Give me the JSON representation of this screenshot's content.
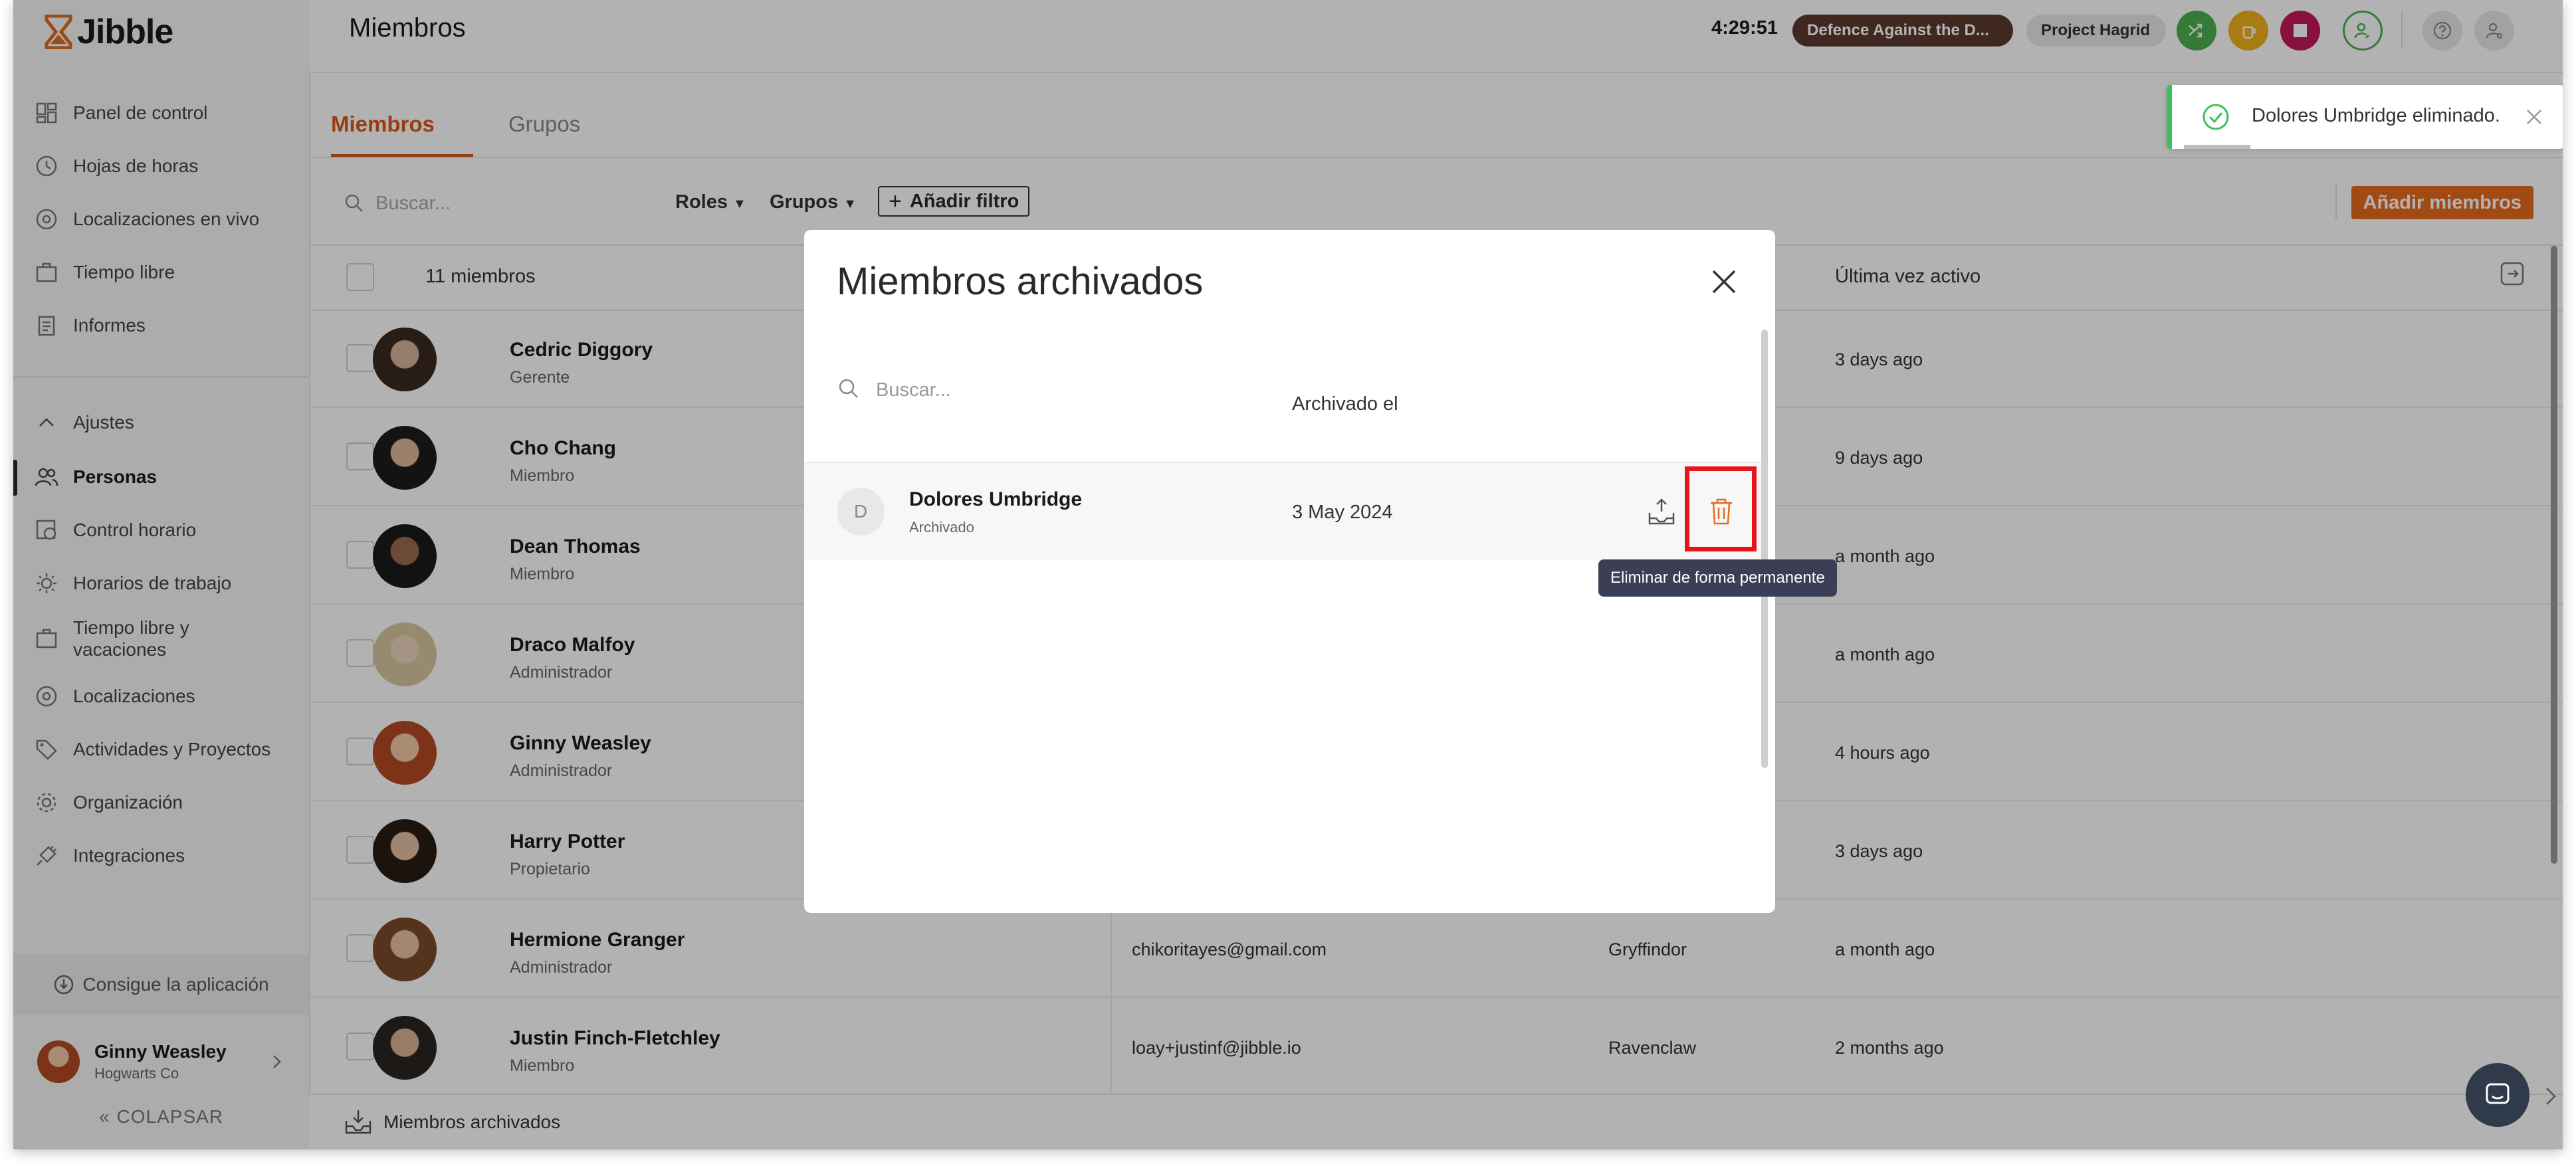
{
  "app": {
    "logo_text": "Jibble"
  },
  "sidebar": {
    "items": [
      {
        "label": "Panel de control",
        "icon": "dashboard-icon"
      },
      {
        "label": "Hojas de horas",
        "icon": "clock-icon"
      },
      {
        "label": "Localizaciones en vivo",
        "icon": "location-pin-icon"
      },
      {
        "label": "Tiempo libre",
        "icon": "suitcase-icon"
      },
      {
        "label": "Informes",
        "icon": "report-icon"
      }
    ],
    "settings_label": "Ajustes",
    "settings_items": [
      {
        "label": "Personas",
        "icon": "people-icon",
        "active": true
      },
      {
        "label": "Control horario",
        "icon": "time-tracking-icon"
      },
      {
        "label": "Horarios de trabajo",
        "icon": "schedule-icon"
      },
      {
        "label": "Tiempo libre y vacaciones",
        "icon": "suitcase-icon"
      },
      {
        "label": "Localizaciones",
        "icon": "location-pin-icon"
      },
      {
        "label": "Actividades y Proyectos",
        "icon": "tag-icon"
      },
      {
        "label": "Organización",
        "icon": "gear-icon"
      },
      {
        "label": "Integraciones",
        "icon": "plug-icon"
      }
    ],
    "get_app": "Consigue la aplicación",
    "profile": {
      "name": "Ginny Weasley",
      "org": "Hogwarts Co"
    },
    "collapse": "COLAPSAR"
  },
  "header": {
    "title": "Miembros",
    "time": "4:29:51",
    "activity_pill": "Defence Against the D...",
    "project_pill": "Project Hagrid"
  },
  "tabs": {
    "members": "Miembros",
    "groups": "Grupos"
  },
  "toolbar": {
    "search_placeholder": "Buscar...",
    "roles": "Roles",
    "groups": "Grupos",
    "add_filter": "Añadir filtro",
    "add_members": "Añadir miembros"
  },
  "table": {
    "count_label": "11 miembros",
    "last_active_header": "Última vez activo",
    "rows": [
      {
        "name": "Cedric Diggory",
        "role": "Gerente",
        "email": "",
        "group": "",
        "last_active": "3 days ago"
      },
      {
        "name": "Cho Chang",
        "role": "Miembro",
        "email": "",
        "group": "",
        "last_active": "9 days ago"
      },
      {
        "name": "Dean Thomas",
        "role": "Miembro",
        "email": "",
        "group": "",
        "last_active": "a month ago"
      },
      {
        "name": "Draco Malfoy",
        "role": "Administrador",
        "email": "",
        "group": "",
        "last_active": "a month ago"
      },
      {
        "name": "Ginny Weasley",
        "role": "Administrador",
        "email": "",
        "group": "",
        "last_active": "4 hours ago"
      },
      {
        "name": "Harry Potter",
        "role": "Propietario",
        "email": "",
        "group": "",
        "last_active": "3 days ago"
      },
      {
        "name": "Hermione Granger",
        "role": "Administrador",
        "email": "chikoritayes@gmail.com",
        "group": "Gryffindor",
        "last_active": "a month ago"
      },
      {
        "name": "Justin Finch-Fletchley",
        "role": "Miembro",
        "email": "loay+justinf@jibble.io",
        "group": "Ravenclaw",
        "last_active": "2 months ago"
      }
    ]
  },
  "footer": {
    "archived_members": "Miembros archivados"
  },
  "modal": {
    "title": "Miembros archivados",
    "search_placeholder": "Buscar...",
    "archived_on_header": "Archivado el",
    "rows": [
      {
        "initial": "D",
        "name": "Dolores Umbridge",
        "status": "Archivado",
        "date": "3 May 2024"
      }
    ],
    "delete_tooltip": "Eliminar de forma permanente"
  },
  "toast": {
    "message": "Dolores Umbridge eliminado."
  },
  "colors": {
    "accent": "#e56a1e",
    "tab_active": "#d9581b",
    "success": "#3fbf5a",
    "highlight_box": "#e8141b",
    "trash": "#e56a1e"
  }
}
